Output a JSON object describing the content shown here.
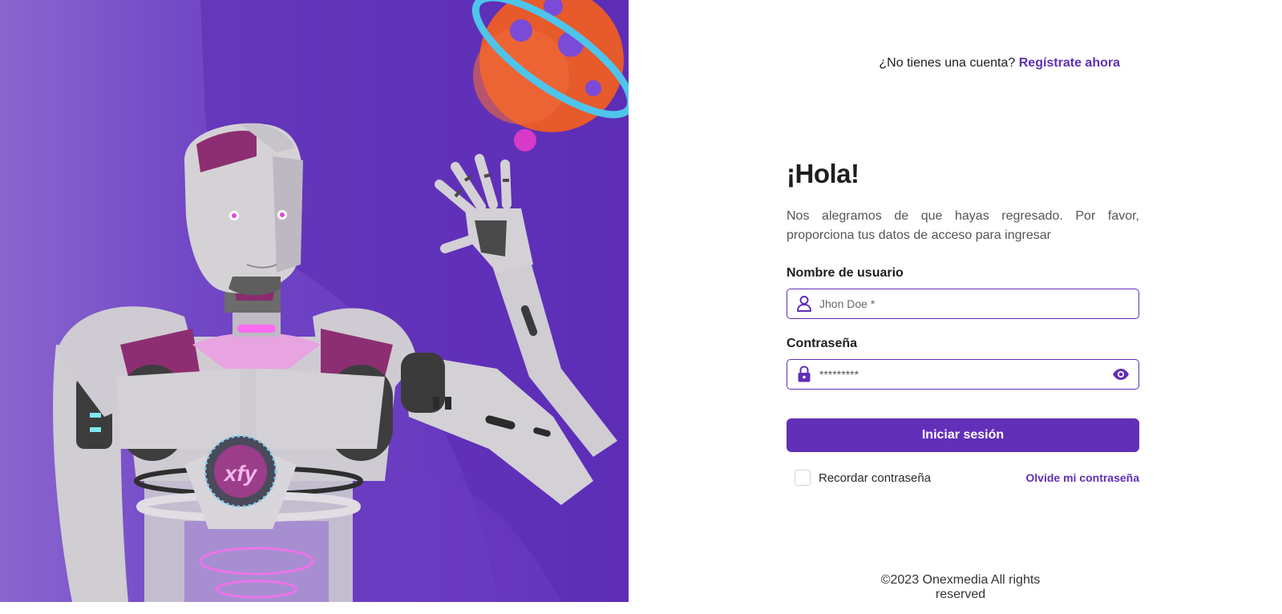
{
  "header": {
    "signup_prompt": "¿No tienes una cuenta?",
    "signup_link": "Regístrate ahora"
  },
  "form": {
    "title": "¡Hola!",
    "subtitle": "Nos alegramos de que hayas regresado. Por favor, proporciona tus datos de acceso para ingresar",
    "username_label": "Nombre de usuario",
    "username_placeholder": "Jhon Doe *",
    "password_label": "Contraseña",
    "password_value": "*********",
    "submit_label": "Iniciar sesión",
    "remember_label": "Recordar contraseña",
    "forgot_label": "Olvide mi contraseña"
  },
  "hero": {
    "robot_chest_logo": "xfy"
  },
  "footer": {
    "copyright": "©2023 Onexmedia All rights reserved"
  },
  "icons": {
    "username": "user-icon",
    "password": "lock-icon",
    "toggle_visibility": "eye-icon"
  },
  "colors": {
    "accent": "#5f2fb8",
    "hero_background": "#6a3cc2",
    "button": "#6230b8"
  }
}
